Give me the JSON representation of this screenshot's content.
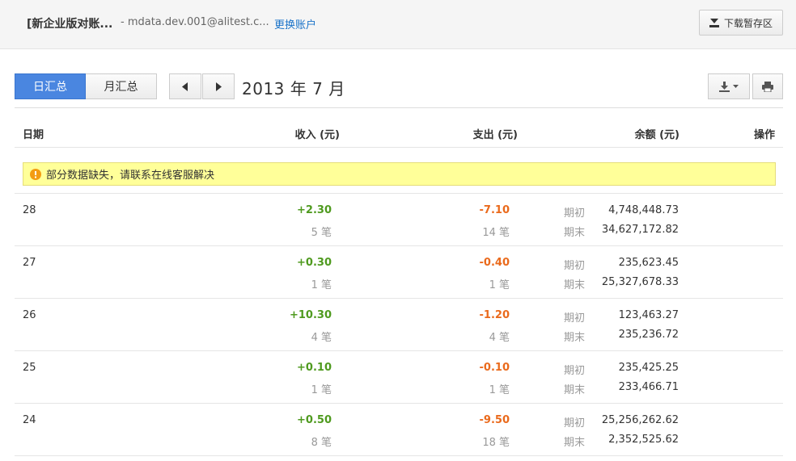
{
  "header": {
    "account_title": "[新企业版对账...",
    "account_email": "- mdata.dev.001@alitest.c...",
    "switch_link": "更换账户",
    "download_area_label": "下载暂存区"
  },
  "tabs": [
    {
      "label": "日汇总",
      "active": true
    },
    {
      "label": "月汇总",
      "active": false
    }
  ],
  "period": "2013 年 7 月",
  "icons": {
    "download_area": "download-tray-icon",
    "prev": "chevron-left-icon",
    "next": "chevron-right-icon",
    "export": "download-icon",
    "export_dropdown": "caret-down-icon",
    "print": "printer-icon",
    "warning": "warning-icon"
  },
  "colors": {
    "primary": "#4a86e0",
    "income": "#4f9a1f",
    "expense": "#ea6a1c",
    "warning_bg": "#ffff99",
    "warning_icon": "#f39c12",
    "link": "#1a73c9"
  },
  "table": {
    "columns": {
      "date": "日期",
      "income": "收入 (元)",
      "expense": "支出 (元)",
      "balance": "余额 (元)",
      "action": "操作"
    },
    "warning": "部分数据缺失，请联系在线客服解决",
    "labels": {
      "opening": "期初",
      "closing": "期末"
    },
    "rows": [
      {
        "date": "28",
        "income": "+2.30",
        "income_count": "5 笔",
        "expense": "-7.10",
        "expense_count": "14 笔",
        "opening_balance": "4,748,448.73",
        "closing_balance": "34,627,172.82"
      },
      {
        "date": "27",
        "income": "+0.30",
        "income_count": "1 笔",
        "expense": "-0.40",
        "expense_count": "1 笔",
        "opening_balance": "235,623.45",
        "closing_balance": "25,327,678.33"
      },
      {
        "date": "26",
        "income": "+10.30",
        "income_count": "4 笔",
        "expense": "-1.20",
        "expense_count": "4 笔",
        "opening_balance": "123,463.27",
        "closing_balance": "235,236.72"
      },
      {
        "date": "25",
        "income": "+0.10",
        "income_count": "1 笔",
        "expense": "-0.10",
        "expense_count": "1 笔",
        "opening_balance": "235,425.25",
        "closing_balance": "233,466.71"
      },
      {
        "date": "24",
        "income": "+0.50",
        "income_count": "8 笔",
        "expense": "-9.50",
        "expense_count": "18 笔",
        "opening_balance": "25,256,262.62",
        "closing_balance": "2,352,525.62"
      }
    ]
  }
}
